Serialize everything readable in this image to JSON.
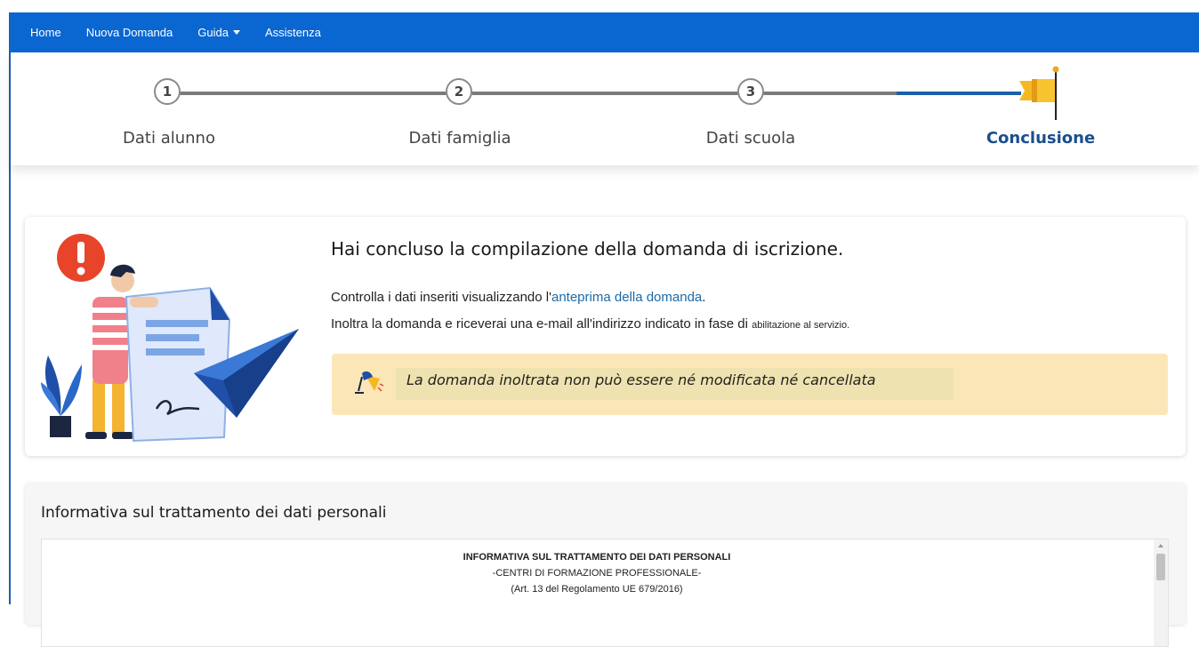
{
  "nav": {
    "items": [
      "Home",
      "Nuova Domanda",
      "Guida",
      "Assistenza"
    ]
  },
  "stepper": {
    "steps": [
      {
        "number": "1",
        "label": "Dati alunno"
      },
      {
        "number": "2",
        "label": "Dati famiglia"
      },
      {
        "number": "3",
        "label": "Dati scuola"
      },
      {
        "label": "Conclusione",
        "active": true
      }
    ]
  },
  "conclusion": {
    "title": "Hai concluso la compilazione della domanda di iscrizione.",
    "line1_before": "Controlla i dati inseriti visualizzando l'",
    "line1_link": "anteprima della domanda",
    "line1_after": ".",
    "line2_main": "Inoltra la domanda e riceverai una e-mail all'indirizzo indicato in fase di ",
    "line2_small": "abilitazione al servizio.",
    "warning": "La domanda inoltrata non può essere né modificata né cancellata"
  },
  "informativa": {
    "section_title": "Informativa sul trattamento dei dati personali",
    "heading": "INFORMATIVA SUL TRATTAMENTO DEI DATI PERSONALI",
    "subheading": "-CENTRI DI FORMAZIONE PROFESSIONALE-",
    "reference": "(Art. 13 del Regolamento UE 679/2016)"
  },
  "colors": {
    "navbar": "#0a66d1",
    "accent": "#1b4f8c",
    "warning_bg": "#fbe6b8",
    "alert_red": "#e8442a",
    "plane_blue": "#1f4fa8"
  },
  "icons": [
    "exclamation-icon",
    "paper-plane-icon",
    "document-icon",
    "plant-icon",
    "flag-icon",
    "lamp-icon"
  ]
}
